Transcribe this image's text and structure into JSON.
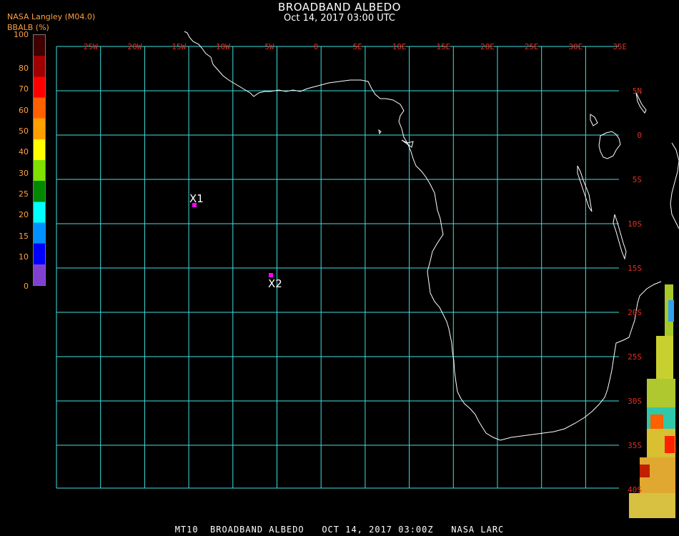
{
  "header": {
    "title": "BROADBAND ALBEDO",
    "subtitle": "Oct 14, 2017 03:00 UTC",
    "source": "NASA Langley (M04.0)"
  },
  "legend": {
    "title": "BBALB (%)",
    "ticks": [
      "100",
      "80",
      "70",
      "60",
      "50",
      "40",
      "30",
      "25",
      "20",
      "15",
      "10",
      "0"
    ],
    "colors": [
      "#400000",
      "#a00000",
      "#ff0000",
      "#ff6000",
      "#ffa000",
      "#ffff00",
      "#80e000",
      "#008800",
      "#00ffff",
      "#0090ff",
      "#0000ff",
      "#8040d0"
    ]
  },
  "map": {
    "grid_color": "#40e0e0",
    "label_color": "#e03020",
    "lon_labels": [
      "25W",
      "20W",
      "15W",
      "10W",
      "5W",
      "0",
      "5E",
      "10E",
      "15E",
      "20E",
      "25E",
      "30E",
      "35E"
    ],
    "lat_labels": [
      "5N",
      "0",
      "5S",
      "10S",
      "15S",
      "20S",
      "25S",
      "30S",
      "35S",
      "40S"
    ],
    "points": [
      {
        "label": "X1",
        "color": "#ff00ff"
      },
      {
        "label": "X2",
        "color": "#ff00ff"
      }
    ]
  },
  "footer": {
    "text": "MT10  BROADBAND ALBEDO   OCT 14, 2017 03:00Z   NASA LARC"
  }
}
